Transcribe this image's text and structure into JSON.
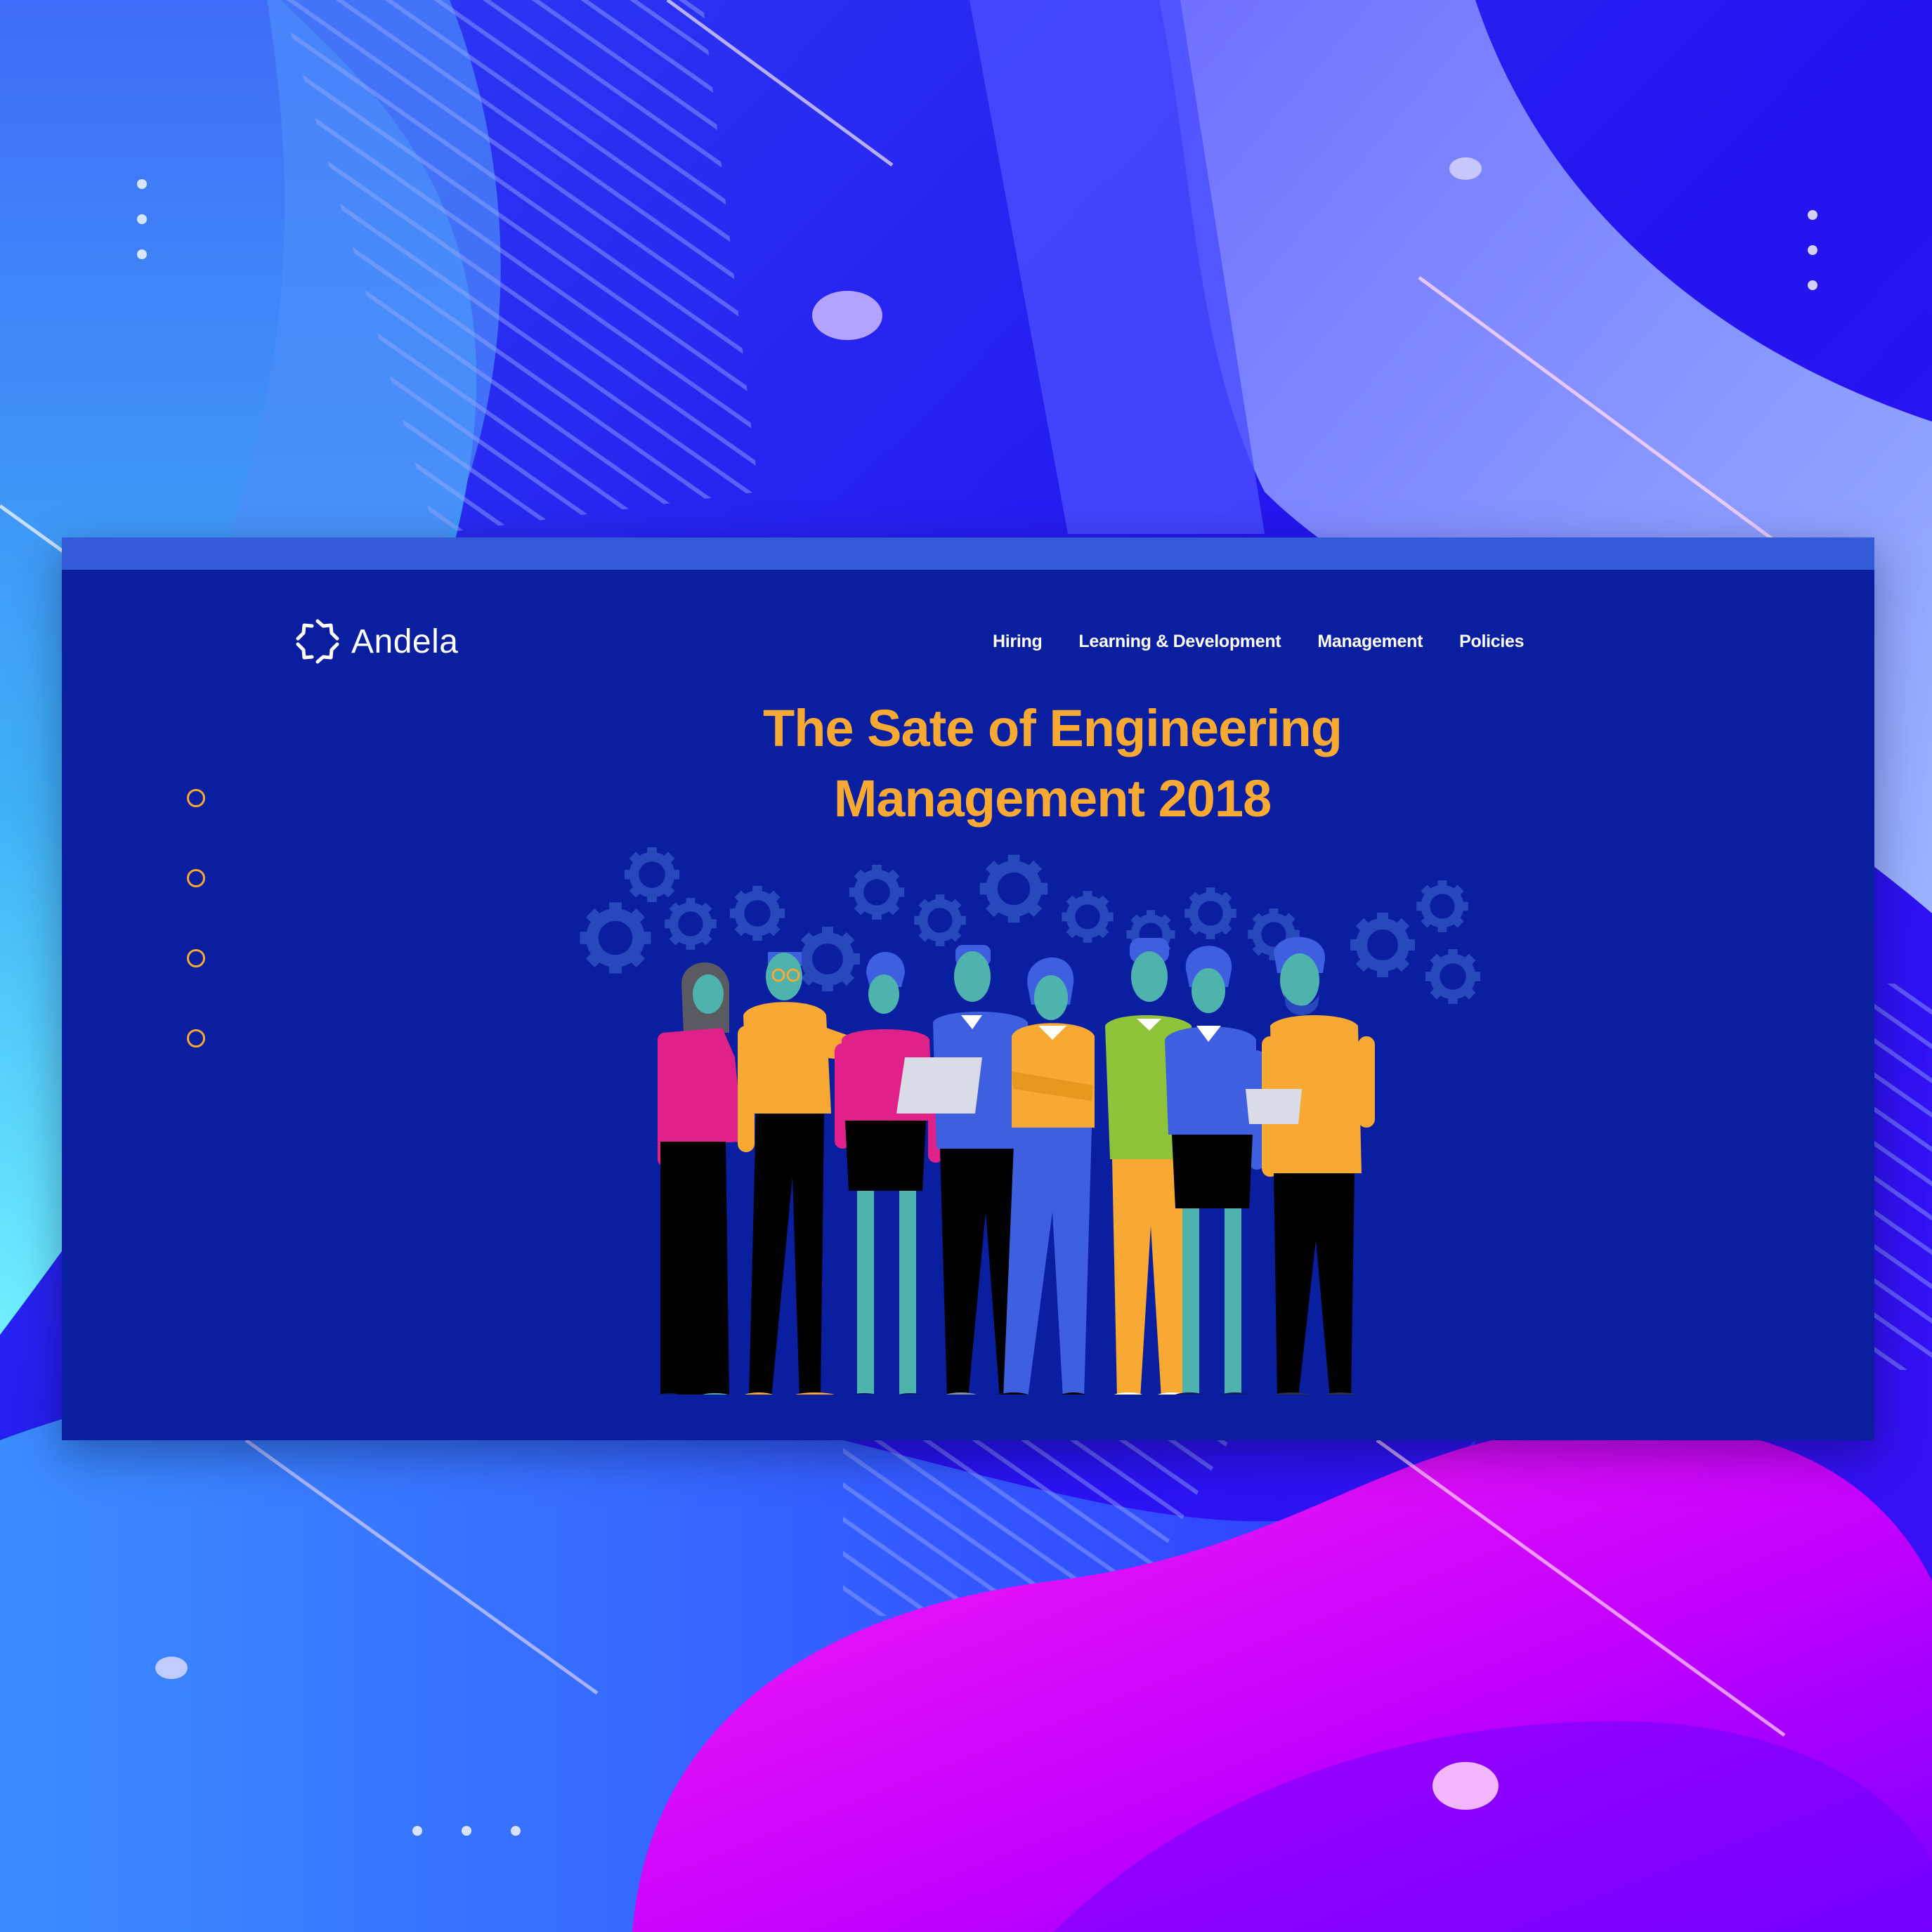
{
  "colors": {
    "browser_background": "#0a1f9f",
    "browser_bar": "#335ad7",
    "accent_orange": "#f7a934",
    "nav_text": "#ffffff"
  },
  "brand": {
    "logo_icon": "andela-logo-icon",
    "name": "Andela"
  },
  "nav": {
    "items": [
      {
        "label": "Hiring"
      },
      {
        "label": "Learning & Development"
      },
      {
        "label": "Management"
      },
      {
        "label": "Policies"
      }
    ]
  },
  "hero": {
    "title_line1": "The Sate of Engineering",
    "title_line2": "Management 2018"
  },
  "slider": {
    "dot_count": 4
  },
  "illustration": {
    "icon": "team-of-engineers-illustration",
    "background_icons": "gear-icon"
  }
}
